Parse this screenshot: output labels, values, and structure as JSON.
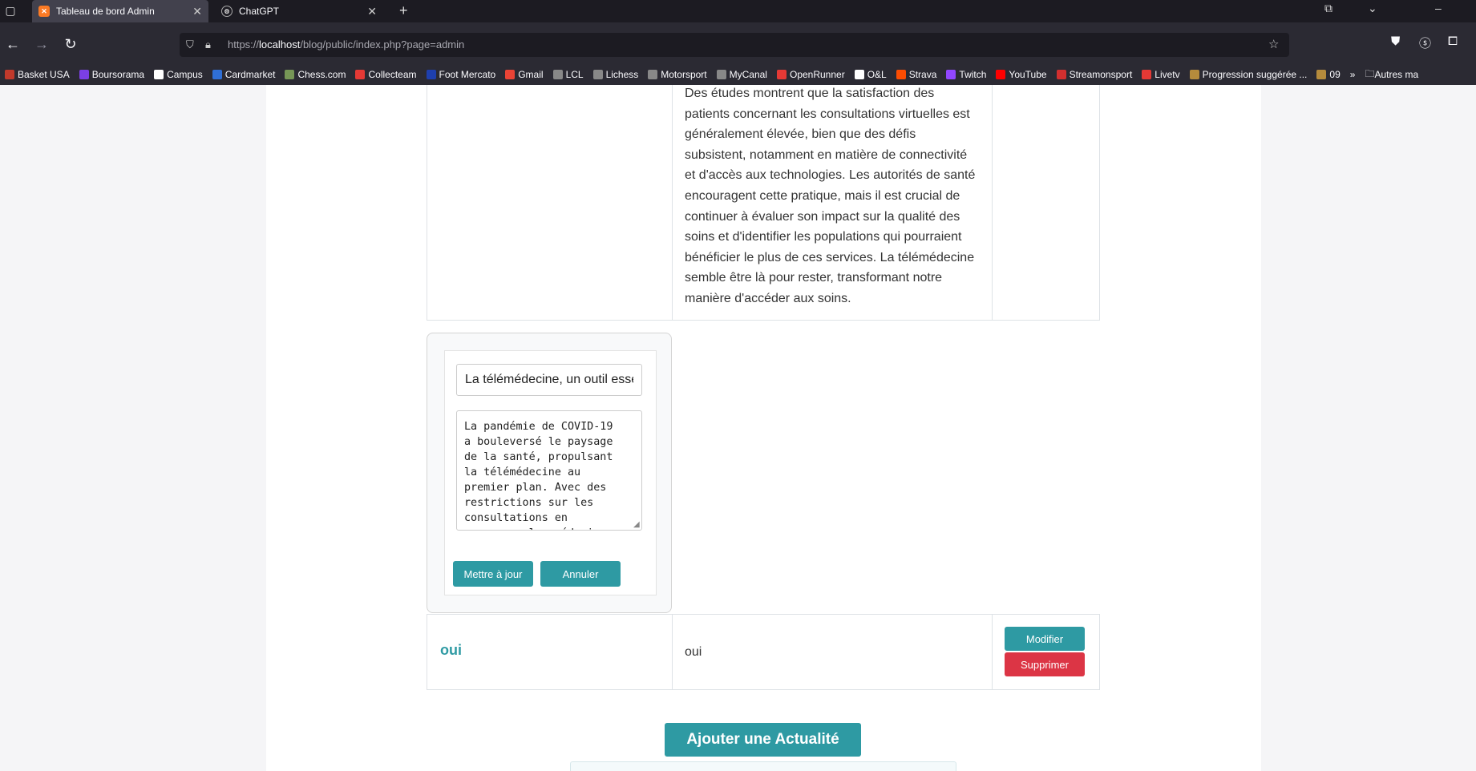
{
  "browser": {
    "tabs": [
      {
        "label": "Tableau de bord Admin",
        "active": true
      },
      {
        "label": "ChatGPT",
        "active": false
      }
    ],
    "url_prefix": "https://",
    "url_host": "localhost",
    "url_path": "/blog/public/index.php?page=admin",
    "bookmarks": [
      {
        "label": "Basket USA",
        "color": "#c0392b"
      },
      {
        "label": "Boursorama",
        "color": "#7b3fe4"
      },
      {
        "label": "Campus",
        "color": "#ffffff"
      },
      {
        "label": "Cardmarket",
        "color": "#2f6fd6"
      },
      {
        "label": "Chess.com",
        "color": "#769656"
      },
      {
        "label": "Collecteam",
        "color": "#e53935"
      },
      {
        "label": "Foot Mercato",
        "color": "#1e3fae"
      },
      {
        "label": "Gmail",
        "color": "#ea4335"
      },
      {
        "label": "LCL",
        "color": "#888888"
      },
      {
        "label": "Lichess",
        "color": "#888888"
      },
      {
        "label": "Motorsport",
        "color": "#888888"
      },
      {
        "label": "MyCanal",
        "color": "#888888"
      },
      {
        "label": "OpenRunner",
        "color": "#e53935"
      },
      {
        "label": "O&L",
        "color": "#ffffff"
      },
      {
        "label": "Strava",
        "color": "#fc4c02"
      },
      {
        "label": "Twitch",
        "color": "#9146ff"
      },
      {
        "label": "YouTube",
        "color": "#ff0000"
      },
      {
        "label": "Streamonsport",
        "color": "#d32f2f"
      },
      {
        "label": "Livetv",
        "color": "#e53935"
      },
      {
        "label": "Progression suggérée ...",
        "color": "#b58b3c"
      },
      {
        "label": "09",
        "color": "#b58b3c"
      }
    ],
    "more_bookmarks": "»",
    "other_bookmarks": "Autres ma"
  },
  "article_row": {
    "content_lines": [
      "Des études montrent que la satisfaction des",
      "patients concernant les consultations virtuelles est",
      "généralement élevée, bien que des défis",
      "subsistent, notamment en matière de connectivité",
      "et d'accès aux technologies. Les autorités de santé",
      "encouragent cette pratique, mais il est crucial de",
      "continuer à évaluer son impact sur la qualité des",
      "soins et d'identifier les populations qui pourraient",
      "bénéficier le plus de ces services. La télémédecine",
      "semble être là pour rester, transformant notre",
      "manière d'accéder aux soins."
    ]
  },
  "edit_form": {
    "title_value": "La télémédecine, un outil esse",
    "content_value": "La pandémie de COVID-19\na bouleversé le paysage\nde la santé, propulsant\nla télémédecine au\npremier plan. Avec des\nrestrictions sur les\nconsultations en\npersonne, les médecins",
    "update_label": "Mettre à jour",
    "cancel_label": "Annuler"
  },
  "second_row": {
    "title": "oui",
    "content": "oui",
    "edit_label": "Modifier",
    "delete_label": "Supprimer"
  },
  "add_button_label": "Ajouter une Actualité",
  "colors": {
    "accent": "#2e9aa3",
    "danger": "#dc3545"
  }
}
